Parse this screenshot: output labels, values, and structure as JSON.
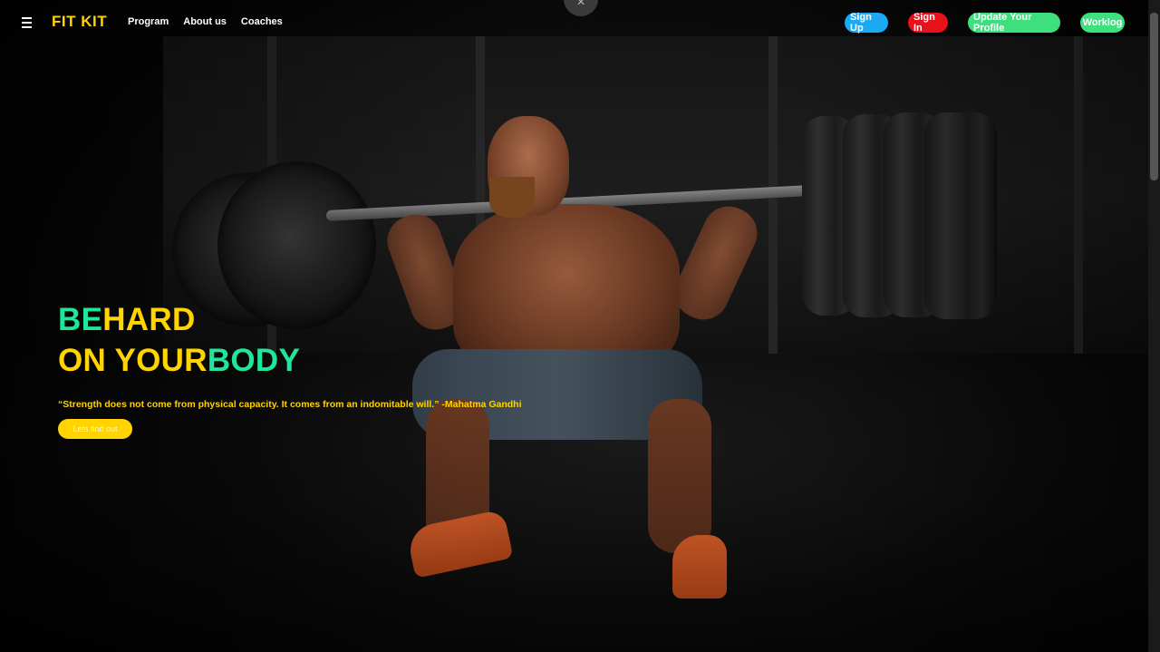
{
  "brand": {
    "name": "FIT KIT"
  },
  "nav": {
    "links": [
      "Program",
      "About us",
      "Coaches"
    ],
    "buttons": {
      "sign_up": "Sign Up",
      "sign_in": "Sign In",
      "update_profile": "Update Your Profile",
      "worklog": "Worklog"
    }
  },
  "close_icon": "×",
  "hero": {
    "line1_part1": "BE",
    "line1_part2": "HARD",
    "line2_part1": "ON YOUR",
    "line2_part2": "BODY",
    "quote": "“Strength does not come from physical capacity. It comes from an indomitable will.” -Mahatma Gandhi",
    "cta": "Lets find out"
  },
  "colors": {
    "brand_yellow": "#ffd400",
    "accent_green": "#20e69a",
    "sign_up_blue": "#1aa9f2",
    "sign_in_red": "#e8101a",
    "profile_green": "#3de07c"
  },
  "icons": {
    "menu": "hamburger-icon",
    "close": "close-icon"
  }
}
